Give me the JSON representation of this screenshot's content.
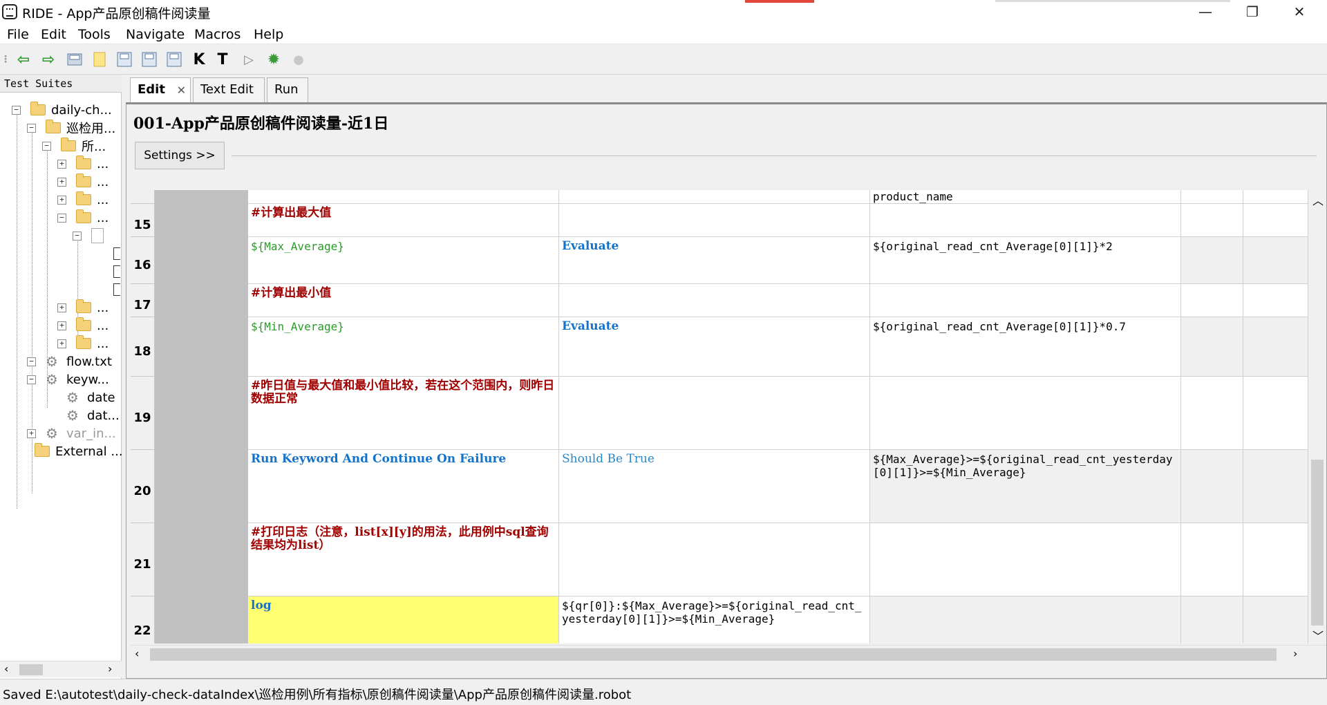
{
  "window": {
    "title": "RIDE - App产品原创稿件阅读量",
    "minimize": "—",
    "restore": "❐",
    "close": "✕"
  },
  "menu": [
    "File",
    "Edit",
    "Tools",
    "Navigate",
    "Macros",
    "Help"
  ],
  "toolbar": {
    "k_label": "K",
    "t_label": "T"
  },
  "tree": {
    "header": "Test Suites",
    "items": {
      "daily": "daily-ch...",
      "xunjian": "巡检用...",
      "suoyou": "所...",
      "f1": "...",
      "f2": "...",
      "f3": "...",
      "f4": "...",
      "f5": "...",
      "f6": "...",
      "f7": "...",
      "flow": "flow.txt",
      "keyw": "keyw...",
      "date": "date",
      "dat": "dat...",
      "varin": "var_in...",
      "external": "External ..."
    }
  },
  "tabs": [
    "Edit",
    "Text Edit",
    "Run"
  ],
  "editor": {
    "suite_title": "001-App产品原创稿件阅读量-近1日",
    "settings_button": "Settings >>"
  },
  "grid": {
    "top_partial": "product_name",
    "rows": [
      {
        "num": "15",
        "c1": "#计算出最大值",
        "c2": "",
        "c3": ""
      },
      {
        "num": "16",
        "c1": "${Max_Average}",
        "c2": "Evaluate",
        "c3": "${original_read_cnt_Average[0][1]}*2"
      },
      {
        "num": "17",
        "c1": "#计算出最小值",
        "c2": "",
        "c3": ""
      },
      {
        "num": "18",
        "c1": "${Min_Average}",
        "c2": "Evaluate",
        "c3": "${original_read_cnt_Average[0][1]}*0.7"
      },
      {
        "num": "19",
        "c1": "#昨日值与最大值和最小值比较，若在这个范围内，则昨日数据正常",
        "c2": "",
        "c3": ""
      },
      {
        "num": "20",
        "c1": "Run Keyword And Continue On Failure",
        "c2": "Should Be True",
        "c3": "${Max_Average}>=${original_read_cnt_yesterday[0][1]}>=${Min_Average}"
      },
      {
        "num": "21",
        "c1": "#打印日志（注意，list[x][y]的用法，此用例中sql查询结果均为list）",
        "c2": "",
        "c3": ""
      },
      {
        "num": "22",
        "c1": "log",
        "c2": "${qr[0]}:${Max_Average}>=${original_read_cnt_yesterday[0][1]}>=${Min_Average}",
        "c3": ""
      }
    ]
  },
  "status": "Saved E:\\autotest\\daily-check-dataIndex\\巡检用例\\所有指标\\原创稿件阅读量\\App产品原创稿件阅读量.robot"
}
